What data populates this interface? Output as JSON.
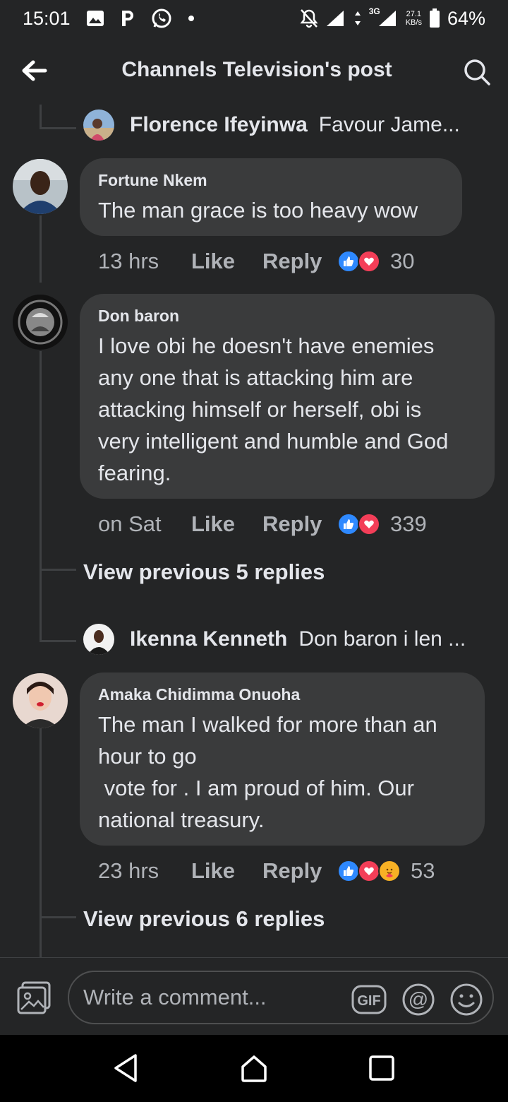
{
  "status_bar": {
    "time": "15:01",
    "left_icons": [
      "image-icon",
      "p-icon",
      "whatsapp-icon",
      "dot-icon"
    ],
    "network": "3G",
    "speed_value": "27.1",
    "speed_unit": "KB/s",
    "battery": "64%"
  },
  "header": {
    "title": "Channels Television's post"
  },
  "comments": [
    {
      "type": "reply_preview",
      "name": "Florence Ifeyinwa",
      "snippet": "Favour Jame..."
    },
    {
      "type": "comment",
      "author": "Fortune Nkem",
      "text": "The man grace is too heavy wow",
      "time": "13 hrs",
      "like_label": "Like",
      "reply_label": "Reply",
      "reactions": [
        "like",
        "love"
      ],
      "reaction_count": "30"
    },
    {
      "type": "comment",
      "author": "Don baron",
      "text": "I love obi he doesn't have enemies\nany one that is attacking him are\nattacking himself or herself, obi is\nvery intelligent and humble and God\nfearing.",
      "time": "on Sat",
      "like_label": "Like",
      "reply_label": "Reply",
      "reactions": [
        "like",
        "love"
      ],
      "reaction_count": "339"
    },
    {
      "type": "view_previous",
      "label": "View previous 5 replies"
    },
    {
      "type": "reply_preview",
      "name": "Ikenna Kenneth",
      "snippet": "Don baron i len ..."
    },
    {
      "type": "comment",
      "author": "Amaka Chidimma Onuoha",
      "text": "The man I walked for more than an\nhour to go\n vote for . I am proud of him. Our\nnational treasury.",
      "time": "23 hrs",
      "like_label": "Like",
      "reply_label": "Reply",
      "reactions": [
        "like",
        "love",
        "care"
      ],
      "reaction_count": "53"
    },
    {
      "type": "view_previous",
      "label": "View previous 6 replies"
    }
  ],
  "composer": {
    "placeholder": "Write a comment...",
    "gif_label": "GIF"
  },
  "colors": {
    "background": "#242526",
    "bubble": "#3a3b3c",
    "like_blue": "#2e89ff",
    "love_red": "#f33e58",
    "care_yellow": "#f7b125"
  }
}
